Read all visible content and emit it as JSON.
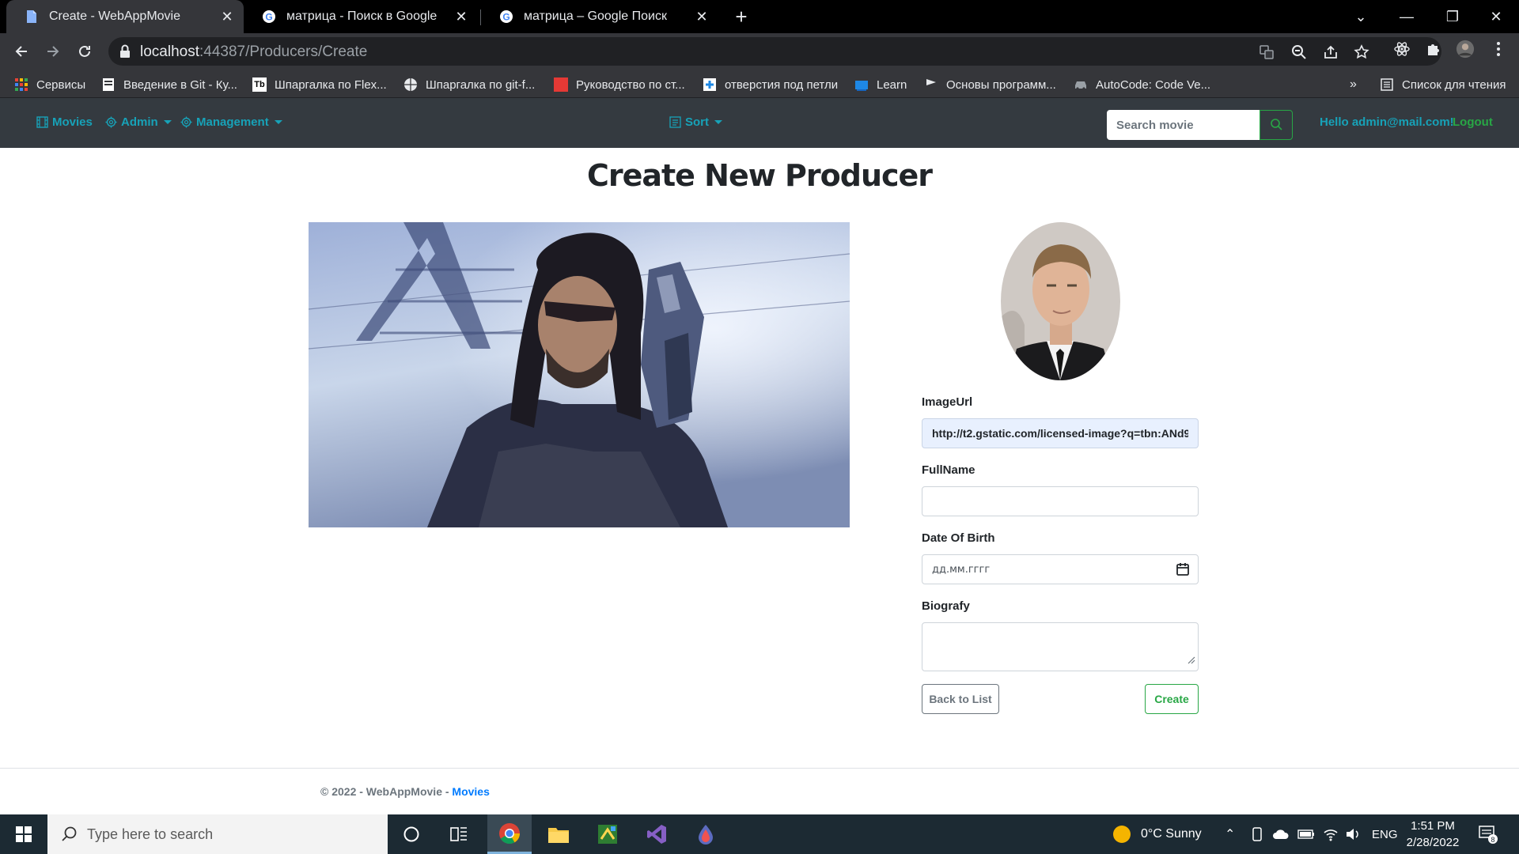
{
  "browser": {
    "tabs": [
      {
        "title": "Create - WebAppMovie",
        "active": true
      },
      {
        "title": "матрица - Поиск в Google",
        "active": false
      },
      {
        "title": "матрица – Google Поиск",
        "active": false
      }
    ],
    "url_host": "localhost",
    "url_rest": ":44387/Producers/Create",
    "bookmarks": [
      {
        "label": "Сервисы",
        "icon": "apps-icon"
      },
      {
        "label": "Введение в Git - Ку...",
        "icon": "bookmark-page-icon"
      },
      {
        "label": "Шпаргалка по Flex...",
        "icon": "tb-logo-icon"
      },
      {
        "label": "Шпаргалка по git-f...",
        "icon": "globe-icon"
      },
      {
        "label": "Руководство по ст...",
        "icon": "red-square-icon"
      },
      {
        "label": "отверстия под петли",
        "icon": "site-icon"
      },
      {
        "label": "Learn",
        "icon": "folder-icon"
      },
      {
        "label": "Основы программ...",
        "icon": "flag-icon"
      },
      {
        "label": "AutoCode: Code Ve...",
        "icon": "car-icon"
      }
    ],
    "more_bookmarks": "»",
    "reading_list": "Список для чтения"
  },
  "nav": {
    "movies": "Movies",
    "admin": "Admin",
    "management": "Management",
    "sort": "Sort",
    "search_placeholder": "Search movie",
    "hello": "Hello admin@mail.com!",
    "logout": "Logout"
  },
  "page": {
    "title": "Create New Producer"
  },
  "form": {
    "image_url_label": "ImageUrl",
    "image_url_value": "http://t2.gstatic.com/licensed-image?q=tbn:ANd9G",
    "fullname_label": "FullName",
    "fullname_value": "",
    "dob_label": "Date Of Birth",
    "dob_placeholder": "дд.мм.гггг",
    "bio_label": "Biografy",
    "back_button": "Back to List",
    "create_button": "Create"
  },
  "footer": {
    "text": "© 2022 - WebAppMovie - ",
    "link": "Movies"
  },
  "taskbar": {
    "search_placeholder": "Type here to search",
    "weather": "0°C  Sunny",
    "language": "ENG",
    "time": "1:51 PM",
    "date": "2/28/2022",
    "notifications": "8"
  },
  "colors": {
    "nav_bg": "#343a40",
    "info": "#17a2b8",
    "success": "#28a745",
    "link": "#007bff"
  }
}
